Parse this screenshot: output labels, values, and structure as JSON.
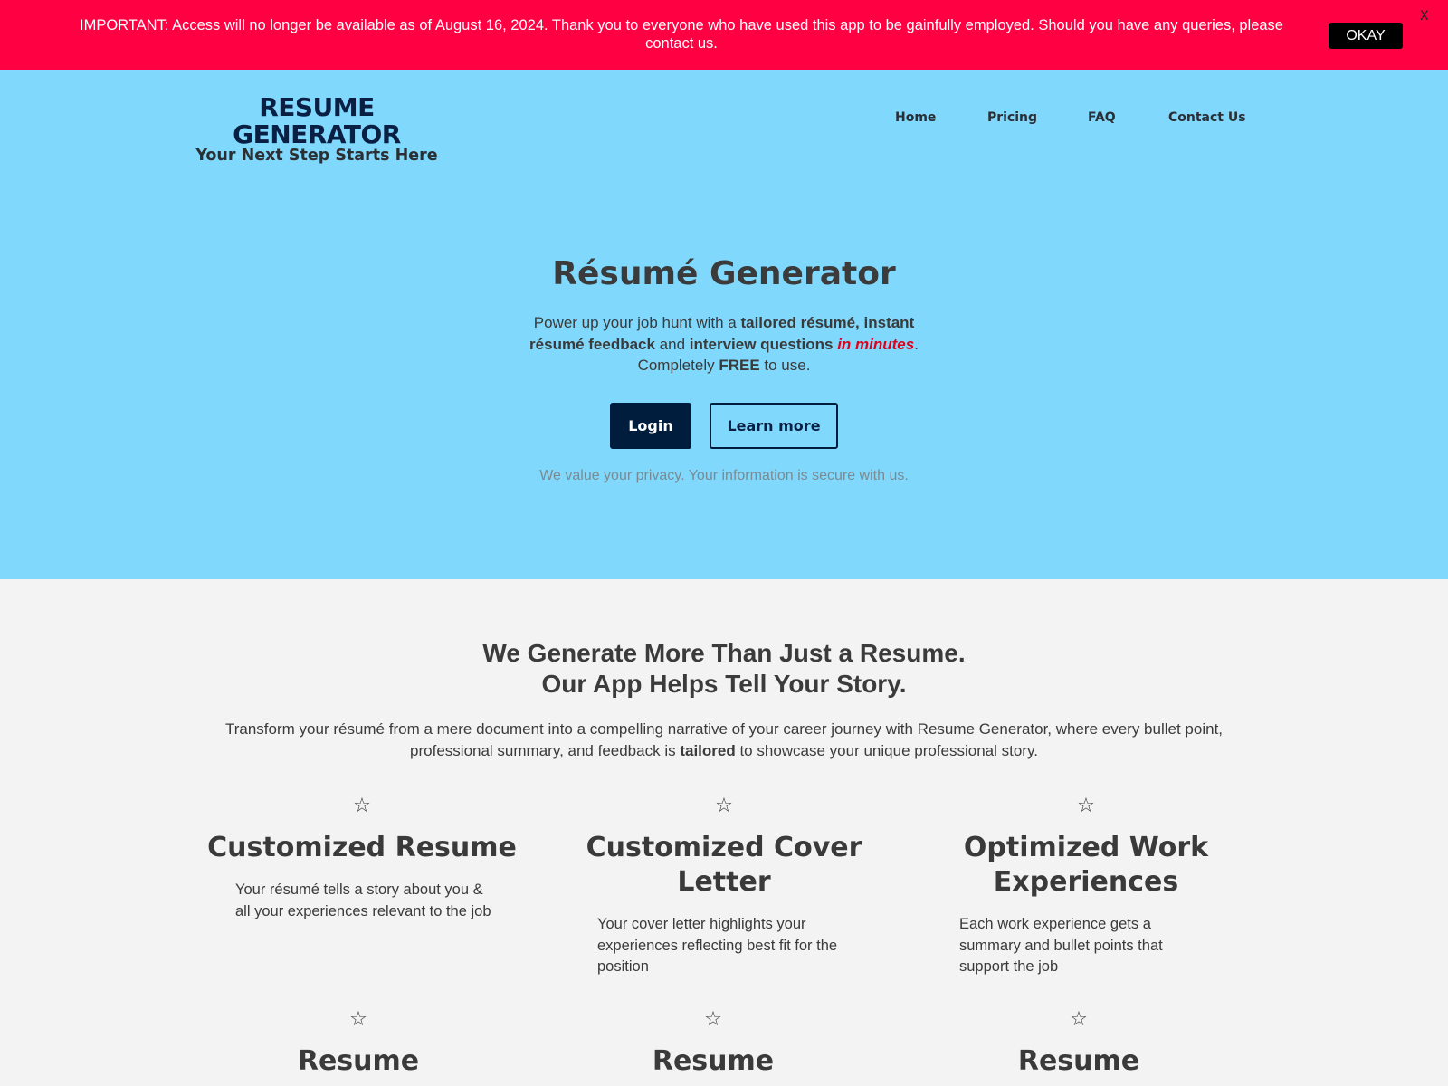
{
  "banner": {
    "message": "IMPORTANT: Access will no longer be available as of August 16, 2024. Thank you to everyone who have used this app to be gainfully employed. Should you have any queries, please contact us.",
    "okay_label": "OKAY",
    "close_label": "X",
    "background_color": "#ff0043"
  },
  "header": {
    "logo_title": "RESUME GENERATOR",
    "logo_subtitle": "Your Next Step Starts Here",
    "nav": [
      {
        "label": "Home"
      },
      {
        "label": "Pricing"
      },
      {
        "label": "FAQ"
      },
      {
        "label": "Contact Us"
      }
    ]
  },
  "hero": {
    "title": "Résumé Generator",
    "desc_1": "Power up your job hunt with a ",
    "desc_bold_1": "tailored résumé, instant résumé feedback",
    "desc_2": " and ",
    "desc_bold_2": "interview questions",
    "desc_3": " ",
    "desc_red": "in minutes",
    "desc_4": ". Completely ",
    "desc_bold_3": "FREE",
    "desc_5": " to use.",
    "login_label": "Login",
    "learn_more_label": "Learn more",
    "privacy_note": "We value your privacy. Your information is secure with us.",
    "background_color": "#80d9fd",
    "accent_color": "#001d3d",
    "highlight_color": "#e0001b"
  },
  "about": {
    "title_line_1": "We Generate More Than Just a Resume.",
    "title_line_2": "Our App Helps Tell Your Story.",
    "desc_1": "Transform your résumé from a mere document into a compelling narrative of your career journey with Resume Generator, where every bullet point, professional summary, and feedback is ",
    "desc_bold": "tailored",
    "desc_2": " to showcase your unique professional story."
  },
  "features": [
    {
      "icon": "star-outline-icon",
      "icon_glyph": "☆",
      "title": "Customized Resume",
      "description": "Your résumé tells a story about you & all your experiences relevant to the job"
    },
    {
      "icon": "star-outline-icon",
      "icon_glyph": "☆",
      "title": "Customized Cover Letter",
      "description": "Your cover letter highlights your experiences reflecting best fit for the position"
    },
    {
      "icon": "star-outline-icon",
      "icon_glyph": "☆",
      "title": "Optimized Work Experiences",
      "description": "Each work experience gets a summary and bullet points that support the job"
    },
    {
      "icon": "star-outline-icon",
      "icon_glyph": "☆",
      "title": "Resume"
    },
    {
      "icon": "star-outline-icon",
      "icon_glyph": "☆",
      "title": "Resume"
    },
    {
      "icon": "star-outline-icon",
      "icon_glyph": "☆",
      "title": "Resume"
    }
  ]
}
